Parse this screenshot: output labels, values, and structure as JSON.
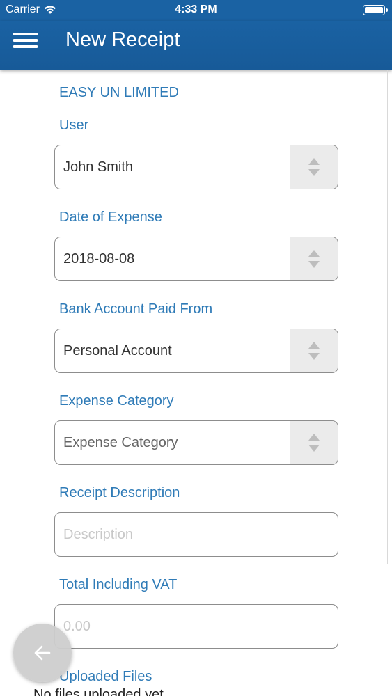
{
  "status_bar": {
    "carrier": "Carrier",
    "time": "4:33 PM"
  },
  "header": {
    "title": "New Receipt",
    "menu_icon": "hamburger-menu-icon",
    "background_color": "#1a62a3"
  },
  "form": {
    "company_name": "EASY UN LIMITED",
    "user": {
      "label": "User",
      "value": "John Smith"
    },
    "date_of_expense": {
      "label": "Date of Expense",
      "value": "2018-08-08"
    },
    "bank_account": {
      "label": "Bank Account Paid From",
      "value": "Personal Account"
    },
    "expense_category": {
      "label": "Expense Category",
      "value": "Expense Category"
    },
    "receipt_description": {
      "label": "Receipt Description",
      "value": "",
      "placeholder": "Description"
    },
    "total_including_vat": {
      "label": "Total Including VAT",
      "value": "",
      "placeholder": "0.00"
    },
    "uploaded_files": {
      "label": "Uploaded Files",
      "empty_text": "No files uploaded yet"
    }
  },
  "back_button": {
    "icon": "arrow-left-icon"
  },
  "colors": {
    "label_blue": "#2f7bb7",
    "border_gray": "#8d8d8d"
  }
}
